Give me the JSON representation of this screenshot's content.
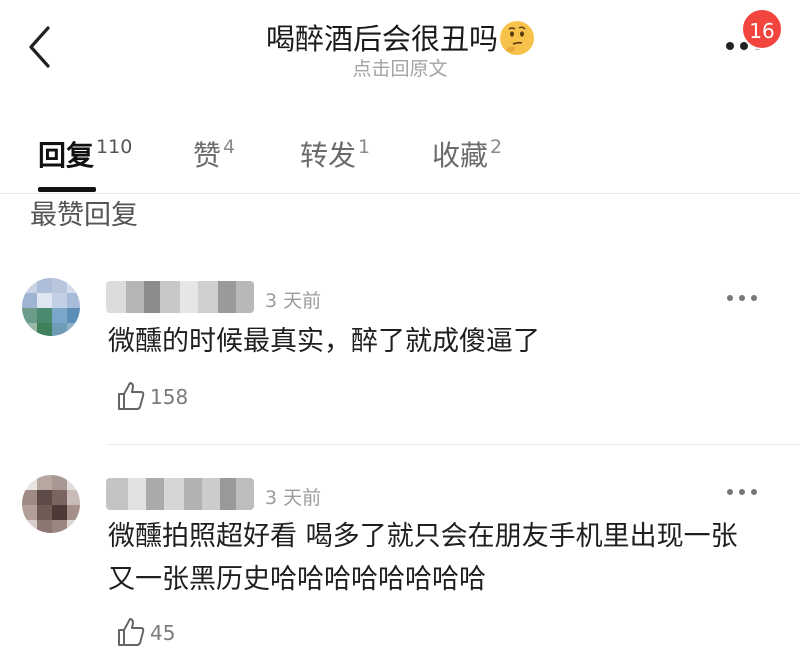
{
  "header": {
    "title": "喝醉酒后会很丑吗",
    "title_emoji": "thinking-face-emoji",
    "subtitle": "点击回原文",
    "notification_count": "16",
    "back_icon": "chevron-left-icon",
    "more_icon": "more-horizontal-icon"
  },
  "tabs": [
    {
      "label": "回复",
      "count": "110",
      "active": true
    },
    {
      "label": "赞",
      "count": "4",
      "active": false
    },
    {
      "label": "转发",
      "count": "1",
      "active": false
    },
    {
      "label": "收藏",
      "count": "2",
      "active": false
    }
  ],
  "section": {
    "title": "最赞回复"
  },
  "comments": [
    {
      "time": "3 天前",
      "text": "微醺的时候最真实，醉了就成傻逼了",
      "likes": "158",
      "like_icon": "thumbs-up-icon",
      "username_hidden": true
    },
    {
      "time": "3 天前",
      "text": "微醺拍照超好看 喝多了就只会在朋友手机里出现一张又一张黑历史哈哈哈哈哈哈哈哈",
      "likes": "45",
      "like_icon": "thumbs-up-icon",
      "username_hidden": true
    }
  ],
  "colors": {
    "badge": "#f2453d",
    "active_tab": "#111111",
    "muted_text": "#9c9c9c"
  }
}
